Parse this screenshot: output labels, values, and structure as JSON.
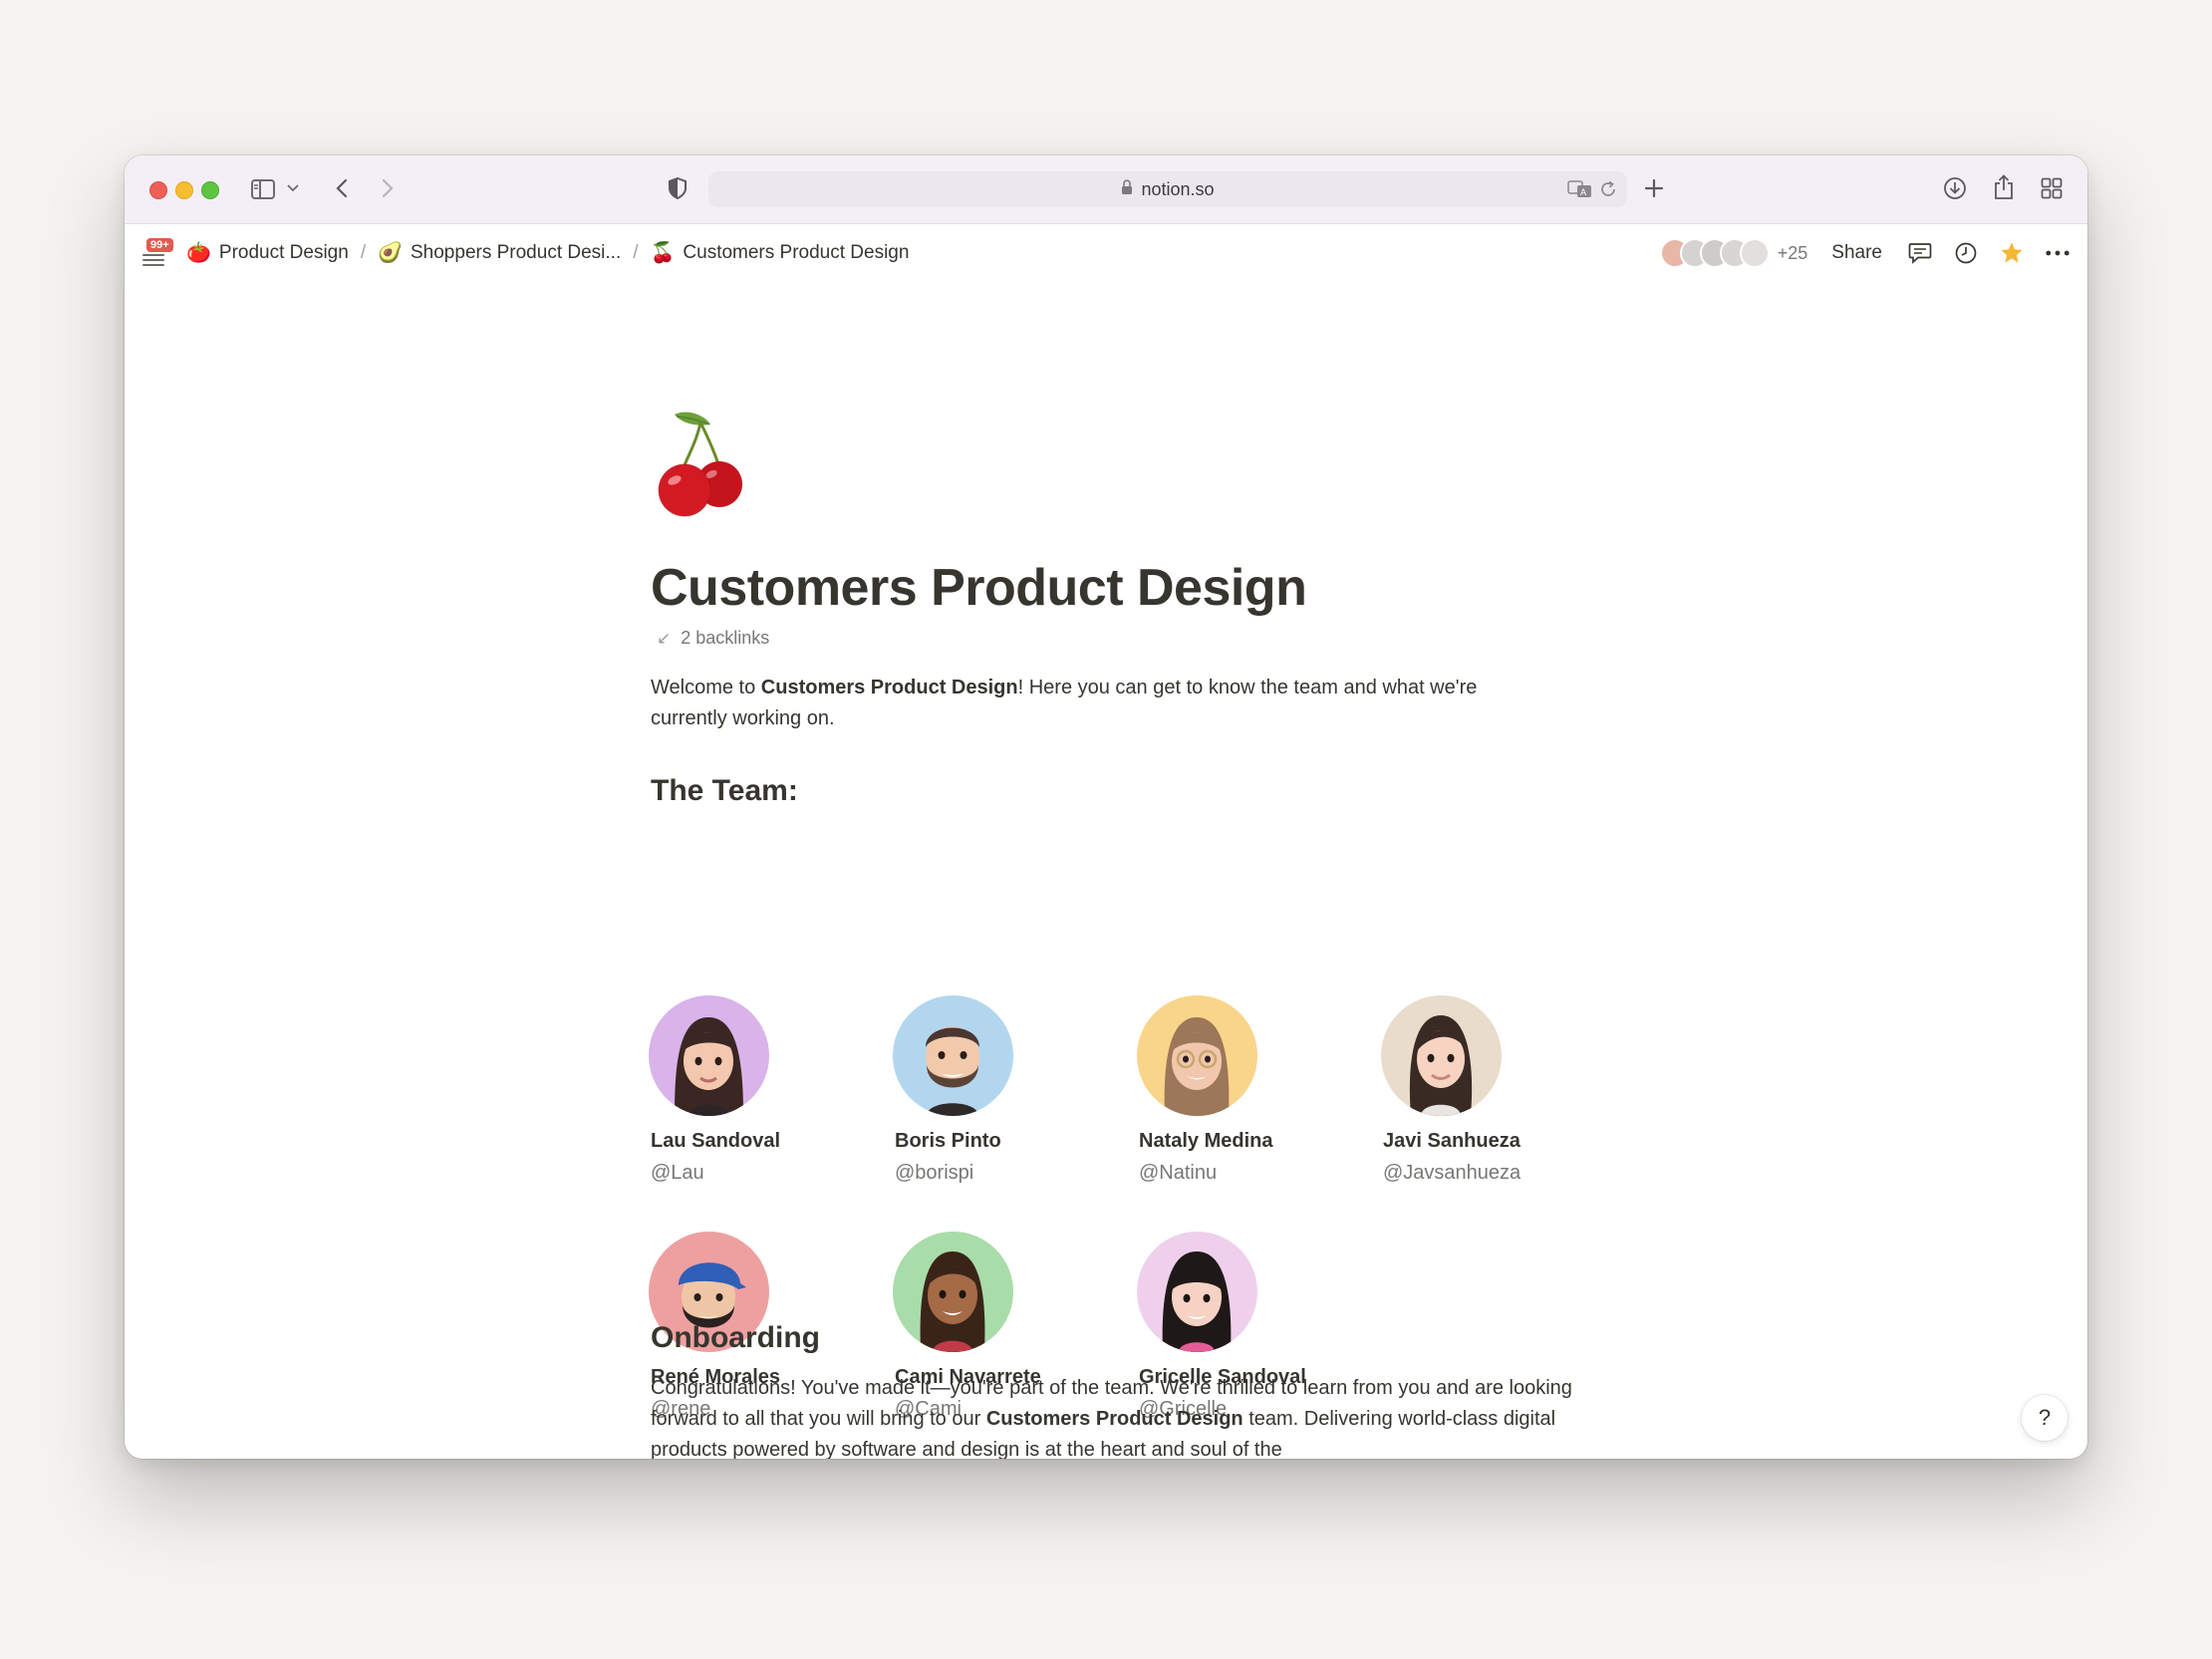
{
  "browser": {
    "url": "notion.so"
  },
  "breadcrumb": {
    "notification_badge": "99+",
    "items": [
      {
        "emoji": "🍅",
        "label": "Product Design"
      },
      {
        "emoji": "🥑",
        "label": "Shoppers Product Desi..."
      },
      {
        "emoji": "🍒",
        "label": "Customers Product Design"
      }
    ],
    "separator": "/"
  },
  "topbar": {
    "collaborators_extra": "+25",
    "share_label": "Share",
    "icons": [
      "comments-icon",
      "updates-clock-icon",
      "favorite-star-icon",
      "more-options-icon"
    ]
  },
  "page": {
    "icon": "cherry-icon",
    "title": "Customers Product Design",
    "backlinks": "2 backlinks",
    "intro": {
      "pre": "Welcome to ",
      "bold": "Customers Product Design",
      "post": "! Here you can get to know the team and what we're currently working on."
    },
    "team_heading": "The Team:",
    "team": [
      {
        "name": "Lau Sandoval",
        "handle": "@Lau",
        "avatar_bg": "#d9b3ea"
      },
      {
        "name": "Boris Pinto",
        "handle": "@borispi",
        "avatar_bg": "#b3d6ef"
      },
      {
        "name": "Nataly Medina",
        "handle": "@Natinu",
        "avatar_bg": "#f9d58a"
      },
      {
        "name": "Javi Sanhueza",
        "handle": "@Javsanhueza",
        "avatar_bg": "#e9dccb"
      },
      {
        "name": "René Morales",
        "handle": "@rene",
        "avatar_bg": "#eea0a0"
      },
      {
        "name": "Cami Navarrete",
        "handle": "@Cami",
        "avatar_bg": "#a8dca8"
      },
      {
        "name": "Gricelle Sandoval",
        "handle": "@Gricelle",
        "avatar_bg": "#efd0ec"
      }
    ],
    "onboarding_heading": "Onboarding",
    "onboarding": {
      "pre": "Congratulations! You've made it—you're part of the team. We're thrilled to learn from you and are looking forward to all that you will bring to our ",
      "bold": "Customers Product Design",
      "post": " team. Delivering world-class digital products powered by software and design is at the heart and soul of the"
    }
  },
  "help_label": "?"
}
